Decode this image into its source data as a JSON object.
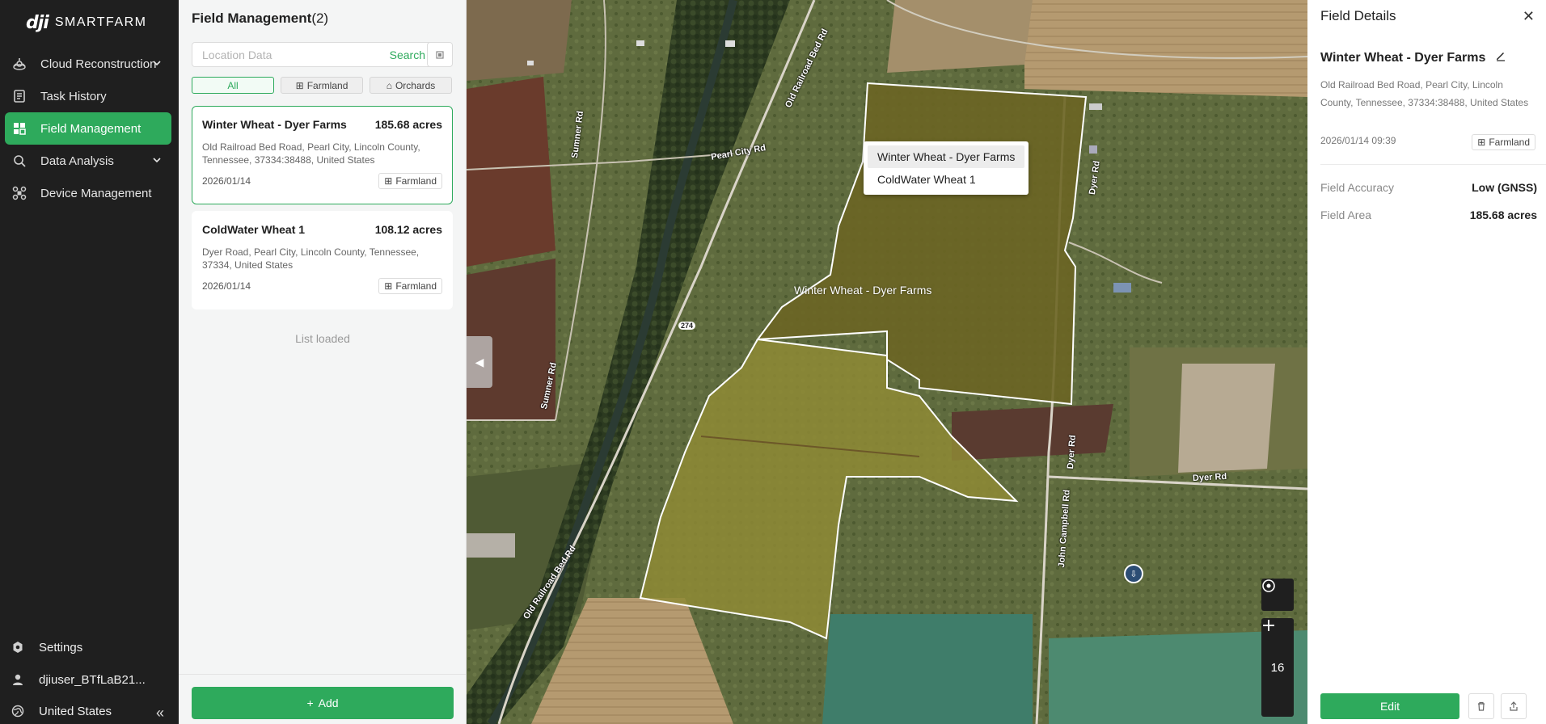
{
  "brand": {
    "logo_mark": "dji",
    "logo_text": "SMARTFARM"
  },
  "nav": {
    "items": [
      {
        "label": "Cloud Reconstruction",
        "icon": "cloud-reconstruction-icon",
        "expandable": true
      },
      {
        "label": "Task History",
        "icon": "task-history-icon",
        "expandable": false
      },
      {
        "label": "Field Management",
        "icon": "field-management-icon",
        "expandable": false,
        "active": true
      },
      {
        "label": "Data Analysis",
        "icon": "data-analysis-icon",
        "expandable": true
      },
      {
        "label": "Device Management",
        "icon": "device-management-icon",
        "expandable": false
      }
    ],
    "settings": "Settings",
    "user": "djiuser_BTfLaB21...",
    "region": "United States"
  },
  "list": {
    "title": "Field Management",
    "count": "(2)",
    "search_placeholder": "Location Data",
    "search_button": "Search",
    "filters": [
      "All",
      "Farmland",
      "Orchards"
    ],
    "fields": [
      {
        "name": "Winter Wheat - Dyer Farms",
        "area": "185.68 acres",
        "address": "Old Railroad Bed Road, Pearl City, Lincoln County, Tennessee, 37334:38488, United States",
        "date": "2026/01/14",
        "tag": "Farmland"
      },
      {
        "name": "ColdWater Wheat 1",
        "area": "108.12 acres",
        "address": "Dyer Road, Pearl City, Lincoln County, Tennessee, 37334, United States",
        "date": "2026/01/14",
        "tag": "Farmland"
      }
    ],
    "status": "List loaded",
    "add_button": "Add"
  },
  "map": {
    "popup_options": [
      "Winter Wheat - Dyer Farms",
      "ColdWater Wheat 1"
    ],
    "field_label": "Winter Wheat - Dyer Farms",
    "roads": {
      "old_railroad_top": "Old Railroad Bed Rd",
      "pearl_city": "Pearl City Rd",
      "sumner_top": "Sumner Rd",
      "sumner_bottom": "Sumner Rd",
      "route": "274",
      "dyer_vertical": "Dyer Rd",
      "dyer_lower": "Dyer Rd",
      "dyer_horizontal": "Dyer Rd",
      "john_campbell": "John Campbell Rd",
      "old_railroad_bottom": "Old Railroad Bed Rd"
    },
    "zoom_level": "16"
  },
  "details": {
    "title": "Field Details",
    "name": "Winter Wheat - Dyer Farms",
    "address": "Old Railroad Bed Road, Pearl City, Lincoln County, Tennessee, 37334:38488, United States",
    "datetime": "2026/01/14 09:39",
    "tag": "Farmland",
    "accuracy_label": "Field Accuracy",
    "accuracy_value": "Low (GNSS)",
    "area_label": "Field Area",
    "area_value": "185.68 acres",
    "edit_button": "Edit"
  },
  "colors": {
    "accent": "#2eaa5c",
    "nav_bg": "#1f1f1f"
  }
}
